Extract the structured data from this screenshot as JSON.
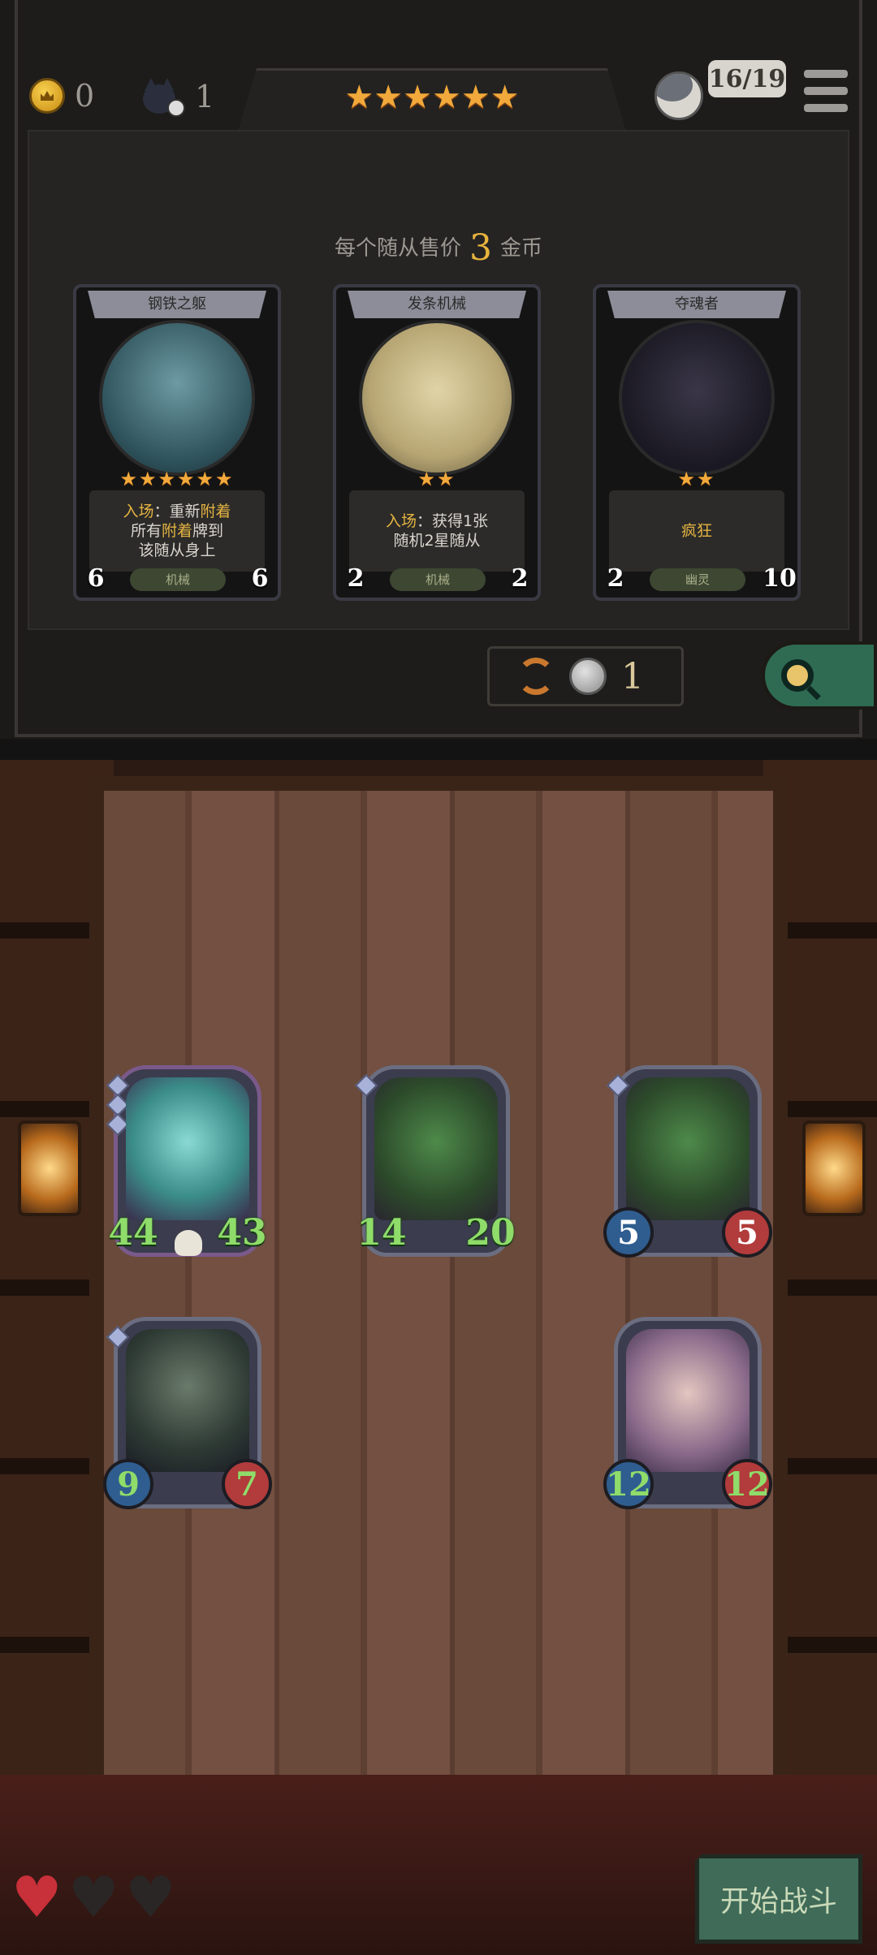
{
  "resources": {
    "gold": "0",
    "cat_count": "1",
    "tier_stars": "★★★★★★",
    "minion_count": "16/19"
  },
  "shop": {
    "price_prefix": "每个随从售价",
    "price_value": "3",
    "price_suffix": "金币",
    "refresh_cost": "1",
    "cards": [
      {
        "name": "钢铁之躯",
        "stars": "★★★★★★",
        "desc_parts": [
          "入场",
          "：重新",
          "附着",
          "所有",
          "附着",
          "牌到",
          "该随从身上"
        ],
        "tag": "机械",
        "attack": "6",
        "health": "6",
        "art_color": "#3e6c78"
      },
      {
        "name": "发条机械",
        "stars": "★★",
        "desc_line1_hl": "入场",
        "desc_line1_rest": "：获得1张",
        "desc_line2": "随机2星随从",
        "tag": "机械",
        "attack": "2",
        "health": "2",
        "art_color": "#c8b98a"
      },
      {
        "name": "夺魂者",
        "stars": "★★",
        "desc": "疯狂",
        "tag": "幽灵",
        "attack": "2",
        "health": "10",
        "art_color": "#1d1b24"
      }
    ]
  },
  "board": {
    "minions": [
      {
        "attack": "44",
        "health": "43"
      },
      {
        "attack": "14",
        "health": "20"
      },
      {
        "attack": "5",
        "health": "5"
      },
      {
        "attack": "9",
        "health": "7"
      },
      {
        "attack": "12",
        "health": "12"
      }
    ]
  },
  "lives": {
    "hearts": [
      "full",
      "empty",
      "empty"
    ]
  },
  "actions": {
    "start_battle": "开始战斗"
  }
}
